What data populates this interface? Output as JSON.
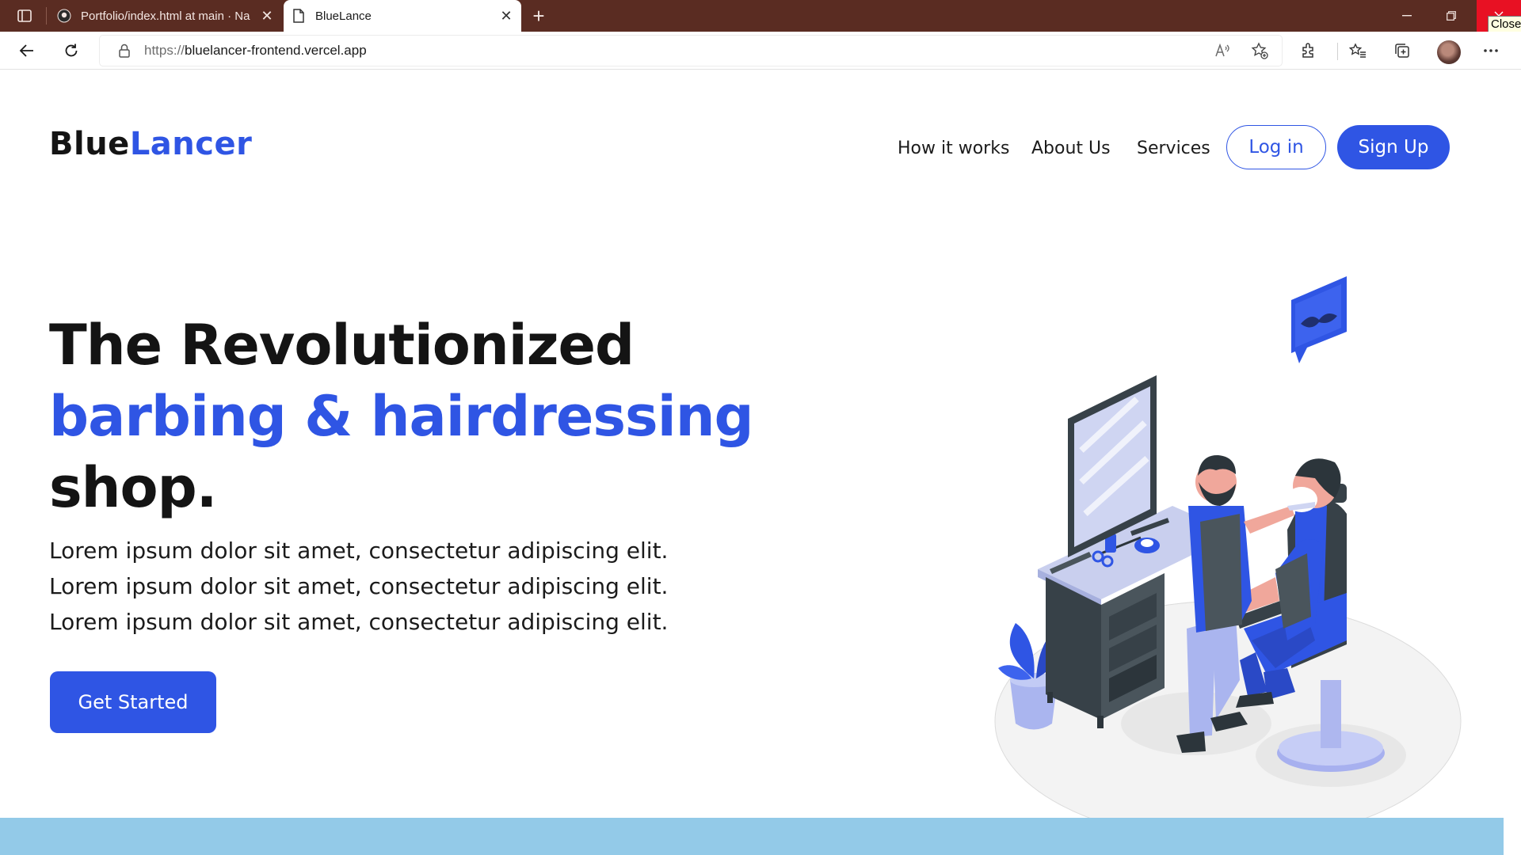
{
  "browser": {
    "tabs": [
      {
        "title": "Portfolio/index.html at main · Na",
        "favicon": "github-icon"
      },
      {
        "title": "BlueLance",
        "favicon": "page-icon"
      }
    ],
    "tooltip": "Close",
    "address": {
      "scheme": "https://",
      "host": "bluelancer-frontend.vercel.app"
    }
  },
  "site": {
    "logo": {
      "part1": "Blue",
      "part2": "Lancer"
    },
    "nav": [
      "How it works",
      "About Us",
      "Services"
    ],
    "login_label": "Log in",
    "signup_label": "Sign Up"
  },
  "hero": {
    "title_line1": "The Revolutionized",
    "title_line2": "barbing & hairdressing",
    "title_line3": "shop.",
    "description": [
      "Lorem ipsum dolor sit amet, consectetur adipiscing elit.",
      "Lorem ipsum dolor sit amet, consectetur adipiscing elit.",
      "Lorem ipsum dolor sit amet, consectetur adipiscing elit."
    ],
    "cta_label": "Get Started"
  },
  "colors": {
    "brand_blue": "#2f55e4",
    "tabbar": "#5a2c22",
    "band": "#93cae8"
  }
}
